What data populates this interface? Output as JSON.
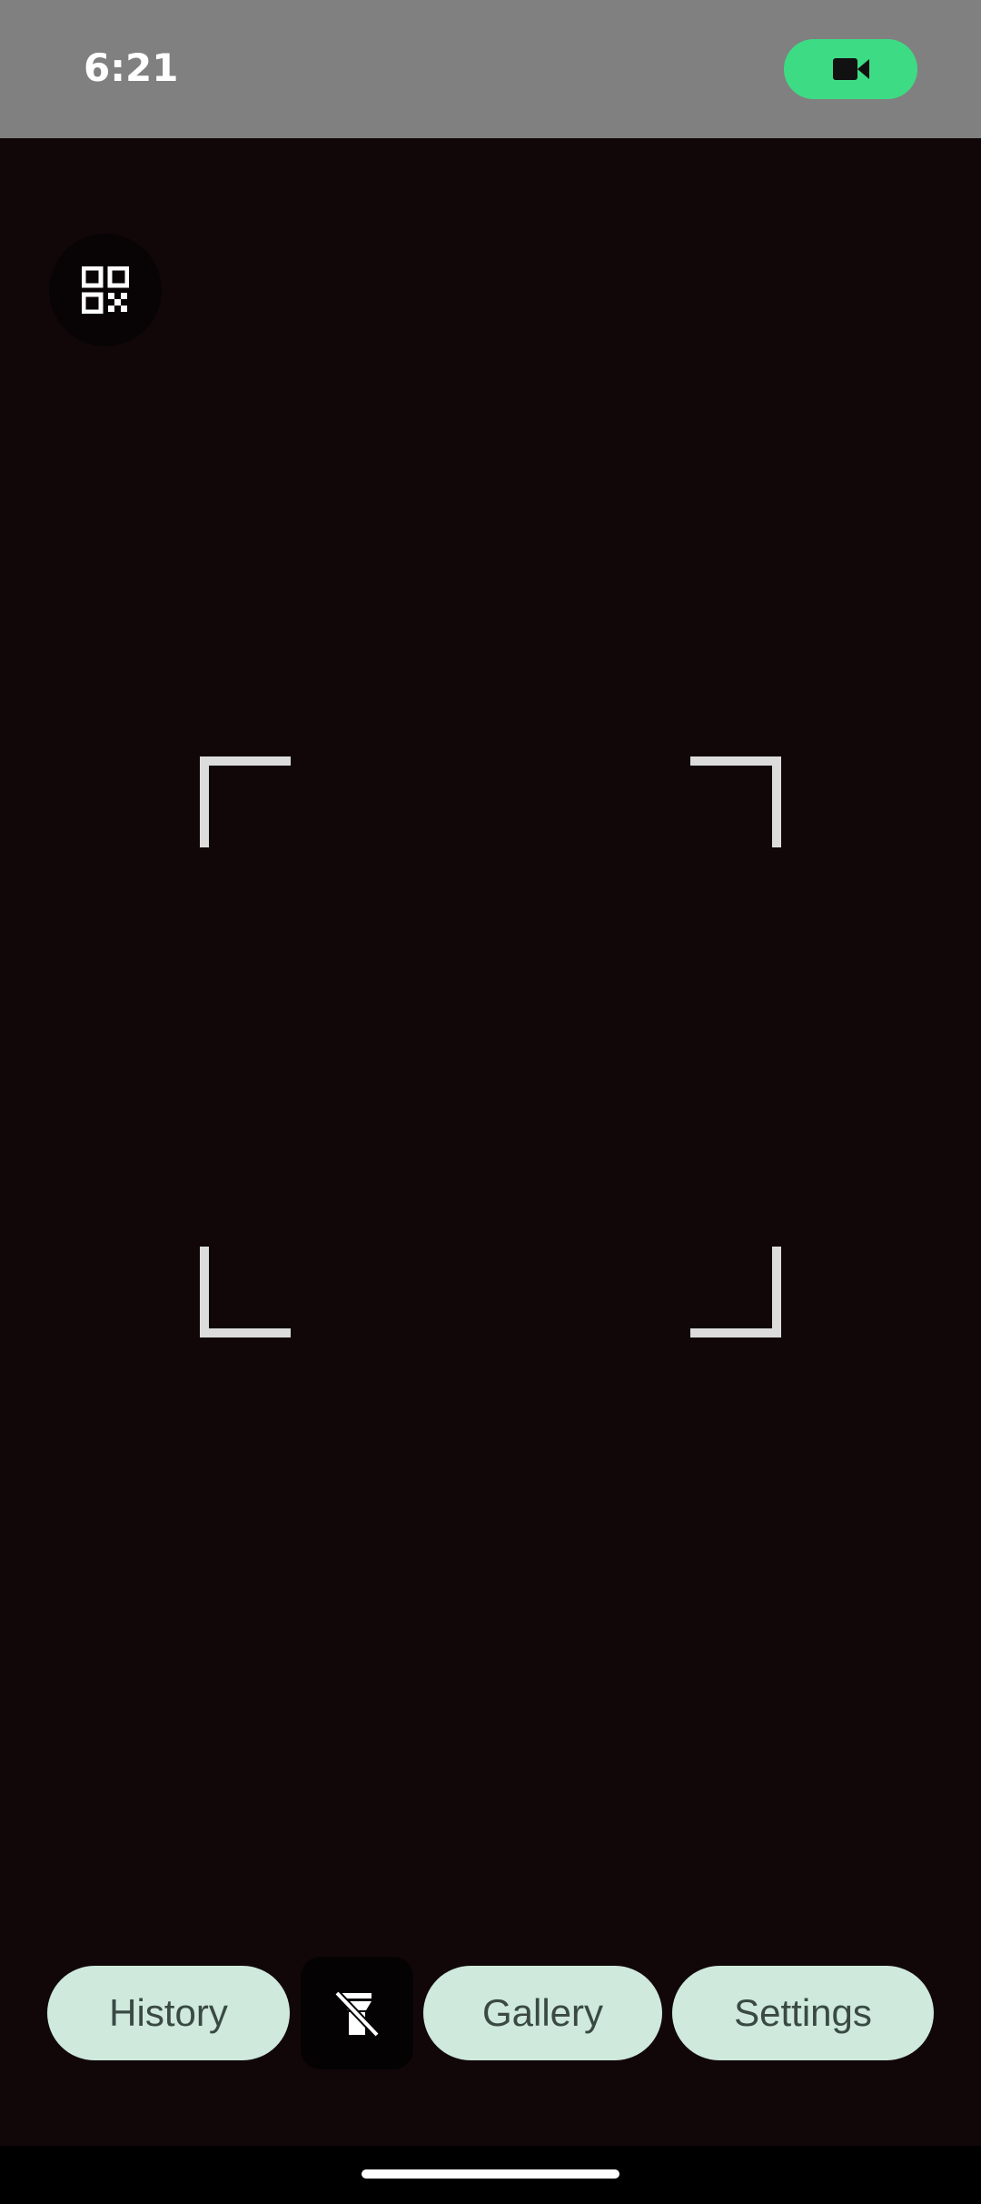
{
  "status_bar": {
    "time": "6:21",
    "recording_icon": "video-camera-icon",
    "recording_color": "#3ddc84"
  },
  "scanner": {
    "mode_icon": "qr-code-icon",
    "frame_color": "#dcdcdc"
  },
  "bottom_bar": {
    "history_label": "History",
    "flash_icon": "flashlight-off-icon",
    "gallery_label": "Gallery",
    "settings_label": "Settings",
    "button_color": "#cfe9dc"
  }
}
